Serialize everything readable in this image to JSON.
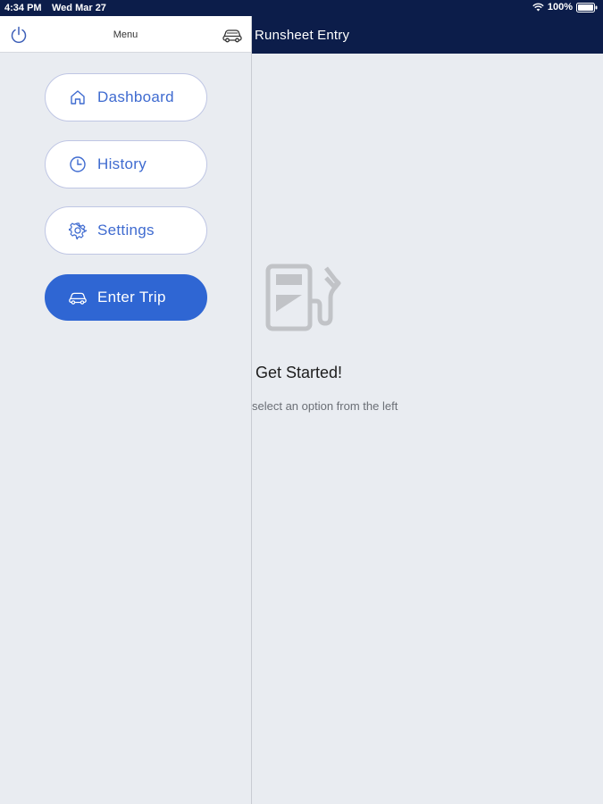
{
  "status": {
    "time": "4:34 PM",
    "date": "Wed Mar 27",
    "battery": "100%",
    "wifi_icon": "wifi-icon",
    "battery_icon": "battery-icon"
  },
  "header": {
    "title": "Runsheet Entry"
  },
  "drawer": {
    "title": "Menu",
    "power_icon": "power-icon",
    "car_icon": "car-icon",
    "items": [
      {
        "label": "Dashboard",
        "icon": "home-icon"
      },
      {
        "label": "History",
        "icon": "clock-icon"
      },
      {
        "label": "Settings",
        "icon": "gear-icon"
      },
      {
        "label": "Enter Trip",
        "icon": "car-icon"
      }
    ]
  },
  "empty_state": {
    "icon": "fuel-pump-icon",
    "title": "Get Started!",
    "subtitle": "select an option from the left"
  },
  "colors": {
    "header_bg": "#0c1d4a",
    "accent": "#2f66d3",
    "page_bg": "#e9ecf1"
  }
}
